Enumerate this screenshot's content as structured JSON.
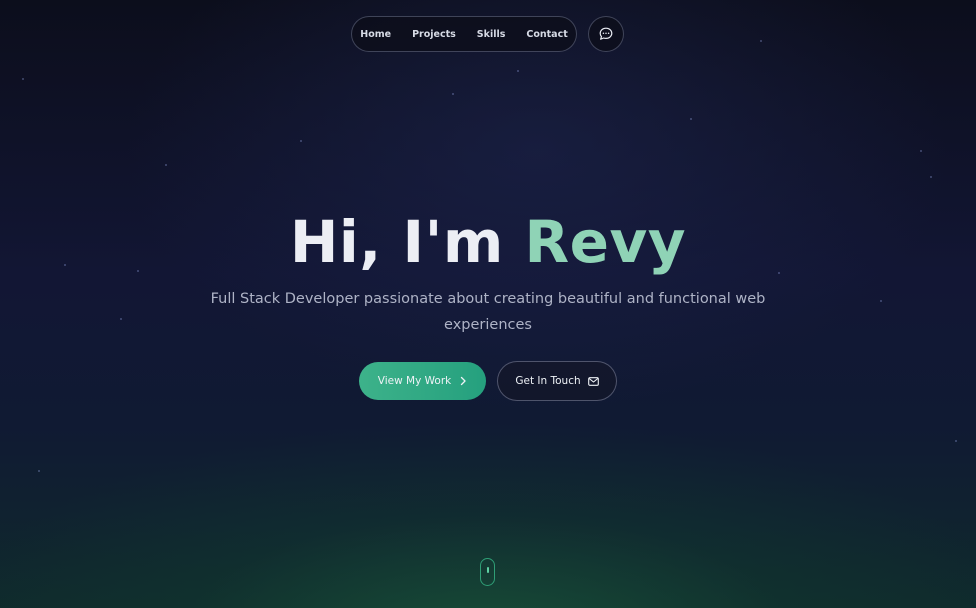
{
  "nav": {
    "items": [
      {
        "label": "Home"
      },
      {
        "label": "Projects"
      },
      {
        "label": "Skills"
      },
      {
        "label": "Contact"
      }
    ],
    "chat_icon": "chat-bubble-icon"
  },
  "hero": {
    "title_lead": "Hi, I'm ",
    "title_name": "Revy",
    "subtitle": "Full Stack Developer passionate about creating beautiful and functional web experiences",
    "primary_button": {
      "label": "View My Work",
      "icon": "chevron-right-icon"
    },
    "secondary_button": {
      "label": "Get In Touch",
      "icon": "mail-icon"
    }
  },
  "scroll_indicator_icon": "mouse-icon",
  "colors": {
    "accent": "#8fd3b6",
    "primary_button": "#35ac87",
    "background": "#121634"
  }
}
